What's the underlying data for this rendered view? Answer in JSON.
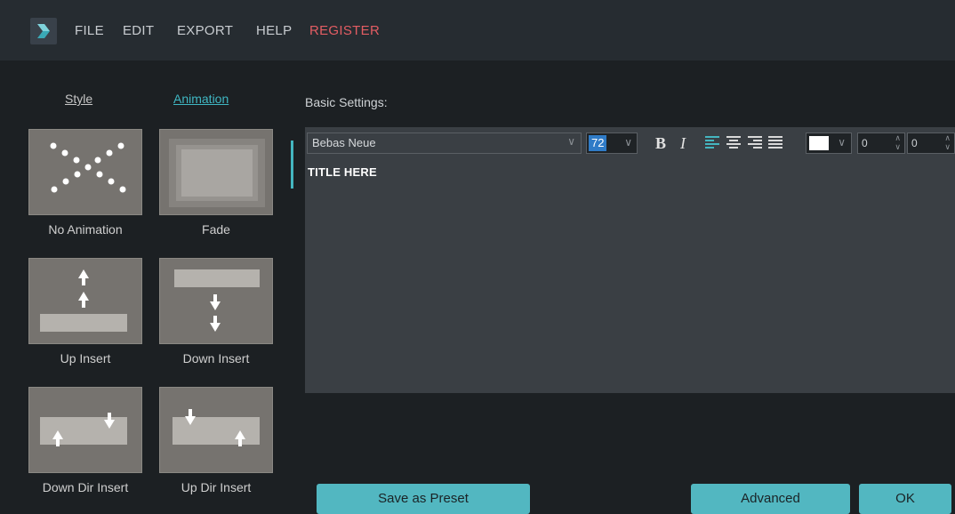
{
  "menu": {
    "items": [
      "FILE",
      "EDIT",
      "EXPORT",
      "HELP"
    ],
    "register": "REGISTER"
  },
  "tabs": {
    "style": "Style",
    "animation": "Animation"
  },
  "animations": [
    "No Animation",
    "Fade",
    "Up Insert",
    "Down Insert",
    "Down Dir Insert",
    "Up Dir Insert"
  ],
  "settings": {
    "label": "Basic Settings:",
    "font": "Bebas Neue",
    "size": "72",
    "bold": "B",
    "italic": "I",
    "text_color": "#ffffff",
    "spin1": "0",
    "spin2": "0",
    "title_text": "TITLE HERE"
  },
  "buttons": {
    "save_preset": "Save as Preset",
    "advanced": "Advanced",
    "ok": "OK"
  },
  "colors": {
    "accent": "#52b7c1",
    "register": "#e35d63",
    "selection": "#2f7bc7"
  }
}
